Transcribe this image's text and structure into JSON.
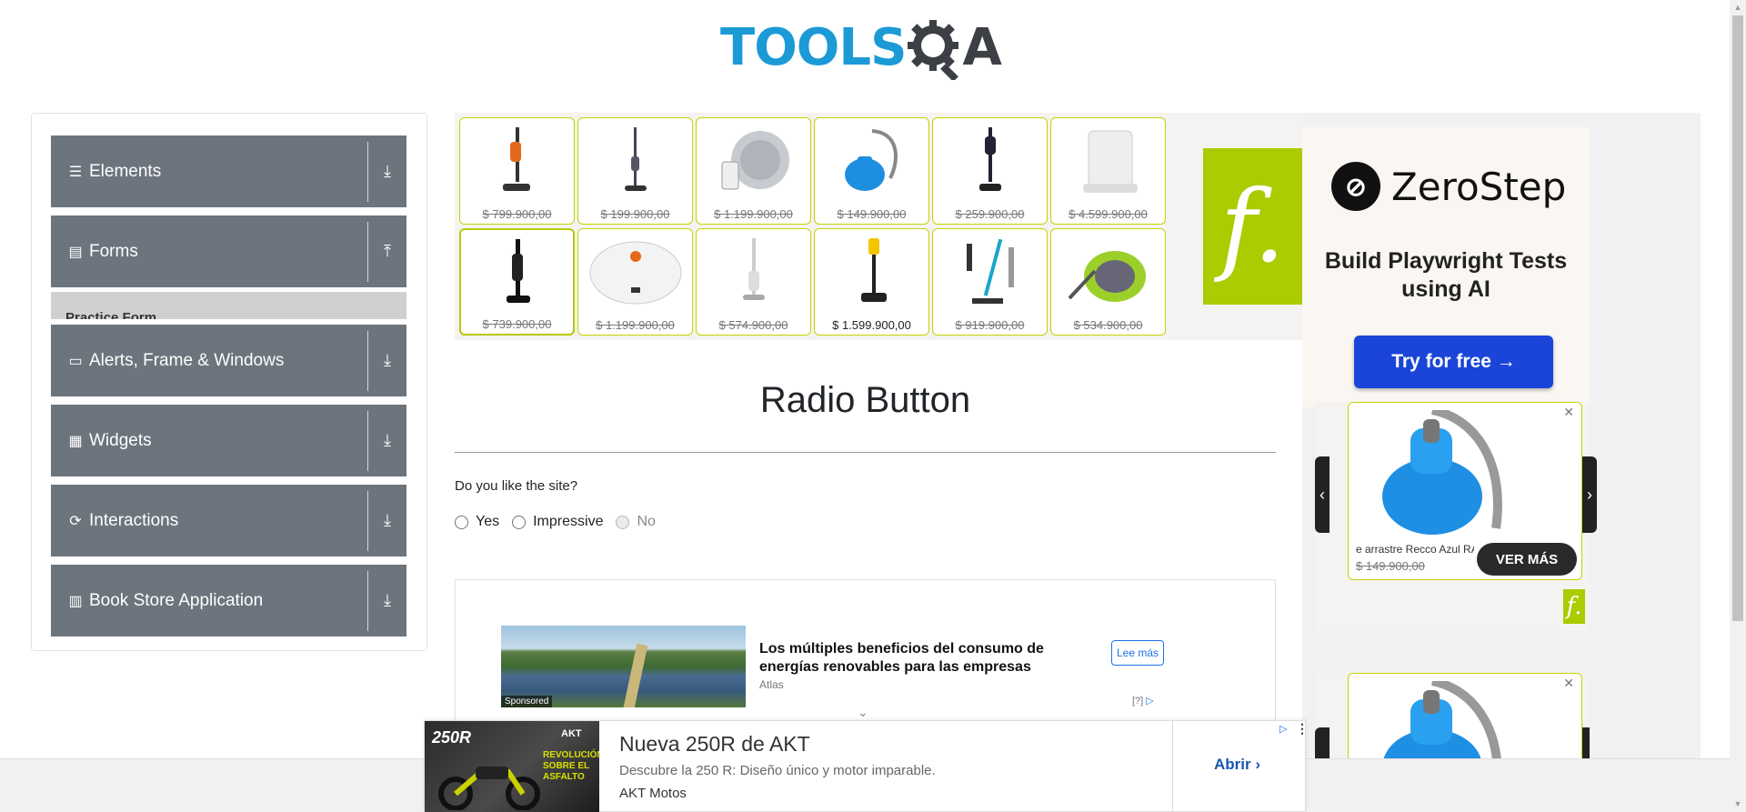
{
  "logo": {
    "text": "TOOLS",
    "suffix": "A"
  },
  "menu": {
    "groups": [
      {
        "label": "Elements",
        "icon": "list-icon"
      },
      {
        "label": "Forms",
        "icon": "document-icon"
      },
      {
        "label": "Alerts, Frame & Windows",
        "icon": "window-icon"
      },
      {
        "label": "Widgets",
        "icon": "grid-icon"
      },
      {
        "label": "Interactions",
        "icon": "refresh-icon"
      },
      {
        "label": "Book Store Application",
        "icon": "books-icon"
      }
    ],
    "partial_subitem": "Practice Form"
  },
  "product_ad": {
    "prices": [
      "$ 799.900,00",
      "$ 199.900,00",
      "$ 1.199.900,00",
      "$ 149.900,00",
      "$ 259.900,00",
      "$ 4.599.900,00",
      "$ 739.900,00",
      "$ 1.199.900,00",
      "$ 574.900,00",
      "$ 1.599.900,00",
      "$ 919.900,00",
      "$ 534.900,00"
    ],
    "brand_glyph": "f."
  },
  "main": {
    "title": "Radio Button",
    "question": "Do you like the site?",
    "options": [
      {
        "label": "Yes",
        "disabled": false
      },
      {
        "label": "Impressive",
        "disabled": false
      },
      {
        "label": "No",
        "disabled": true
      }
    ]
  },
  "sponsored_ad": {
    "badge": "Sponsored",
    "headline": "Los múltiples beneficios del consumo de energías renovables para las empresas",
    "source": "Atlas",
    "cta": "Lee más",
    "info": "[?]"
  },
  "zerostep_ad": {
    "name": "ZeroStep",
    "tagline": "Build Playwright Tests using AI",
    "cta": "Try for free →"
  },
  "carousel_ad": {
    "product_name": "e arrastre Recco Azul RA",
    "price": "$ 149.900,00",
    "cta": "VER MÁS",
    "close": "✕",
    "brand_glyph": "f."
  },
  "sticky_ad": {
    "title": "Nueva 250R de AKT",
    "description": "Descubre la 250 R: Diseño único y motor imparable.",
    "advertiser": "AKT Motos",
    "cta": "Abrir",
    "model": "250R",
    "brand": "AKT",
    "slogan": "REVOLUCIÓN SOBRE EL ASFALTO"
  }
}
